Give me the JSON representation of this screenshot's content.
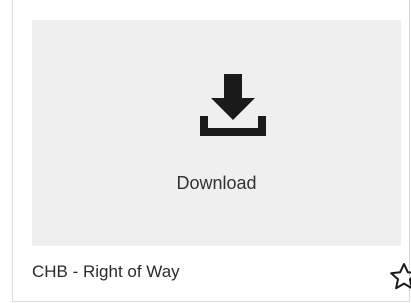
{
  "card": {
    "thumbnail": {
      "icon": "download-icon",
      "label": "Download"
    },
    "title": "CHB - Right of Way",
    "favorite_icon": "star-outline-icon"
  },
  "colors": {
    "thumbnail_bg": "#efefef",
    "icon": "#1a1a1a",
    "border": "#d9d9d9"
  }
}
